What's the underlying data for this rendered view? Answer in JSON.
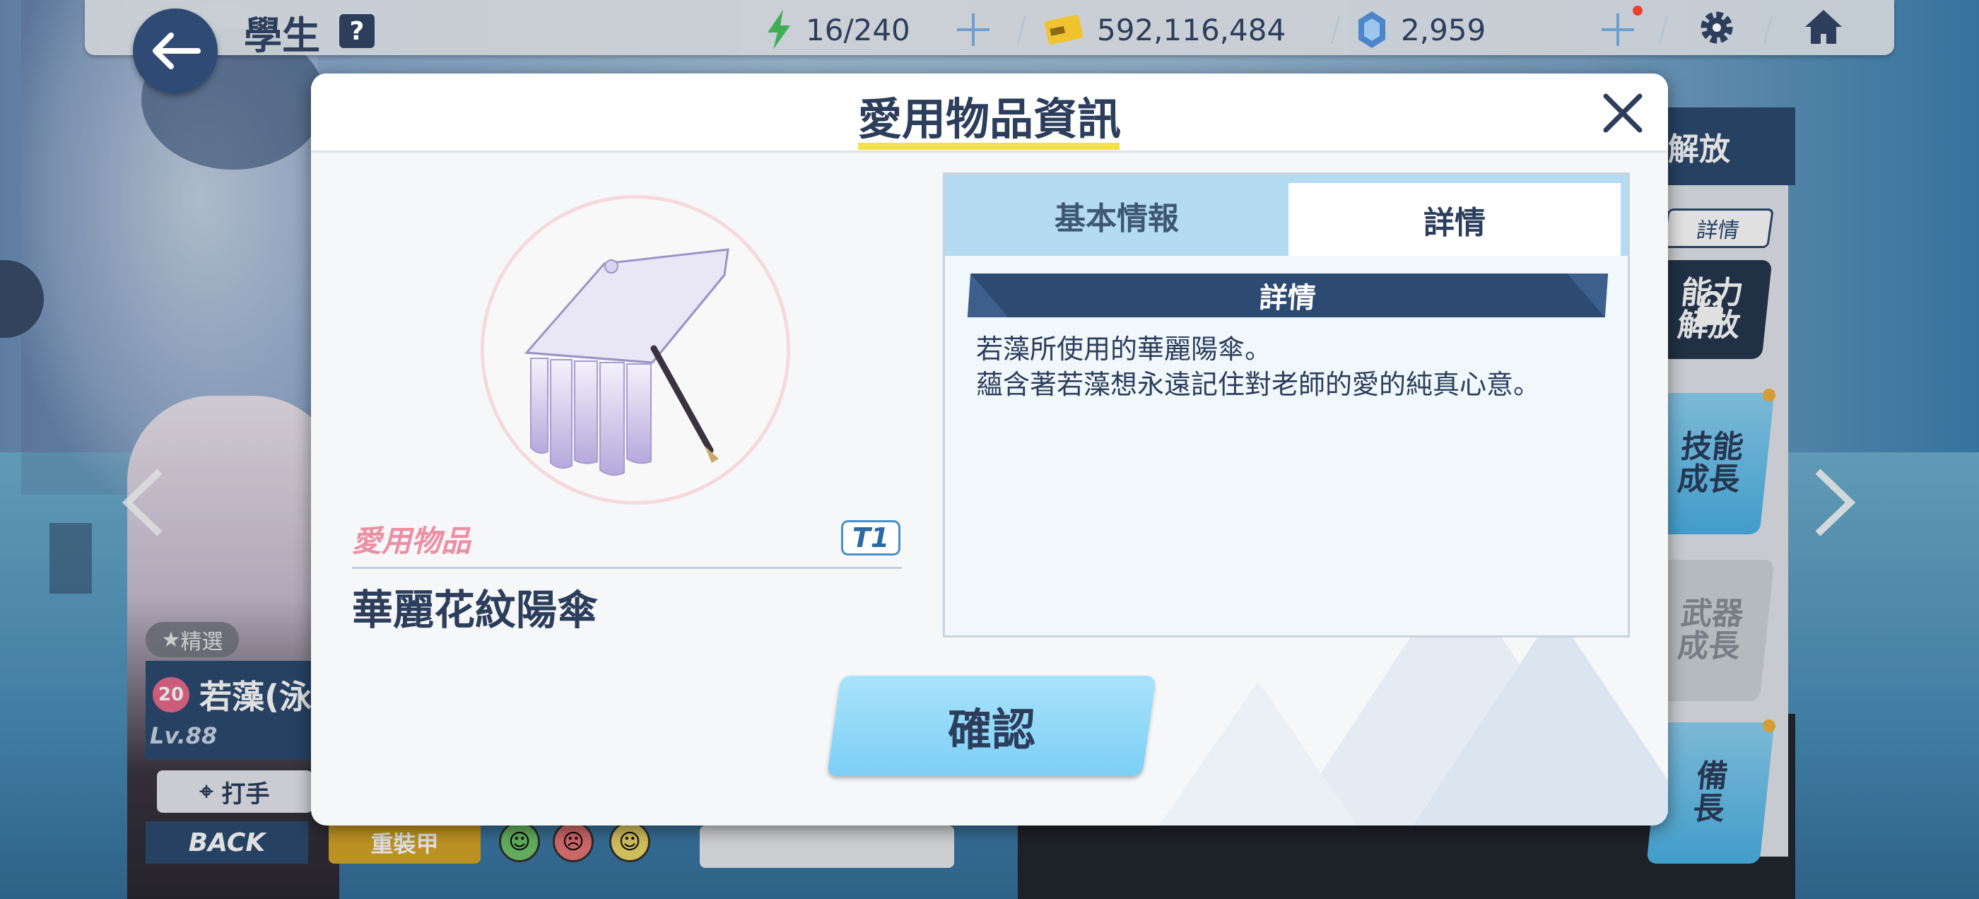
{
  "topbar": {
    "title": "學生",
    "help": "?",
    "ap": "16/240",
    "credits": "592,116,484",
    "gems": "2,959"
  },
  "side_menu": {
    "header": "解放",
    "detail_tab": "詳情",
    "ability_line1": "能力",
    "ability_line2": "解放",
    "skill_line1": "技能",
    "skill_line2": "成長",
    "weapon_line1": "武器",
    "weapon_line2": "成長",
    "equip_line1": "備",
    "equip_line2": "長"
  },
  "character": {
    "featured": "精選",
    "affection": "20",
    "name": "若藻(泳",
    "level": "Lv.88",
    "role": "打手",
    "position": "BACK",
    "armor": "重裝甲"
  },
  "modal": {
    "title": "愛用物品資訊",
    "item_category": "愛用物品",
    "tier": "T1",
    "item_name": "華麗花紋陽傘",
    "tabs": [
      "基本情報",
      "詳情"
    ],
    "active_tab": "詳情",
    "section_title": "詳情",
    "description_lines": [
      "若藻所使用的華麗陽傘。",
      "蘊含著若藻想永遠記住對老師的愛的純真心意。"
    ],
    "confirm_label": "確認"
  },
  "colors": {
    "navy": "#2c3e5c",
    "accent_blue": "#7dcff5",
    "pink": "#ec8fa3",
    "title_underline": "#f4e04d"
  },
  "icons": [
    "back-arrow-icon",
    "ap-bolt-icon",
    "credit-card-icon",
    "gem-icon",
    "plus-icon",
    "gear-icon",
    "home-icon",
    "close-icon",
    "lock-icon",
    "parasol-icon",
    "chevron-left-icon",
    "chevron-right-icon"
  ]
}
